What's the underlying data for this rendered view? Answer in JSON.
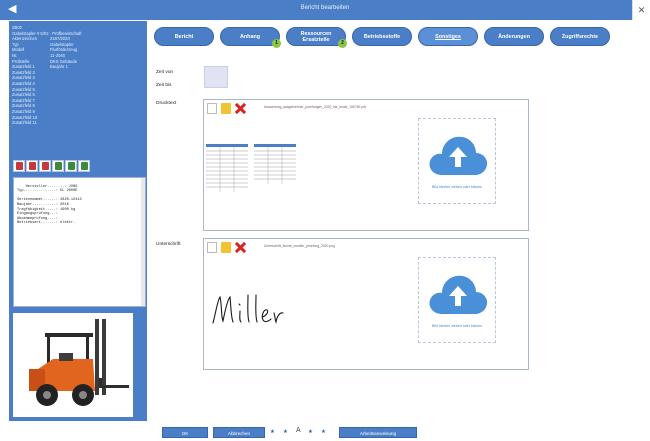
{
  "titlebar": {
    "back_icon": "arrow-left-icon",
    "title": "Bericht bearbeiten",
    "close_icon": "close-icon"
  },
  "info": {
    "heading": "ZB02",
    "subheading": "Gabelstapler # 5/02 · Prüfbereitschaft",
    "fields": [
      {
        "key": "Aktenzeichen",
        "value": "2187/2020"
      },
      {
        "key": "Typ",
        "value": "Gabelstapler"
      },
      {
        "key": "Modell",
        "value": "Flurförderzeug"
      },
      {
        "key": "Nr.",
        "value": "11-2040"
      },
      {
        "key": "Prüfstelle",
        "value": "DKS Gebäude"
      },
      {
        "key": "Zusatzfeld 1",
        "value": "Baujahr 1"
      }
    ],
    "extra_fields": [
      "Zusatzfeld 2",
      "Zusatzfeld 3",
      "Zusatzfeld 4",
      "Zusatzfeld 5",
      "Zusatzfeld 6",
      "Zusatzfeld 7",
      "Zusatzfeld 8",
      "Zusatzfeld 9",
      "Zusatzfeld 10",
      "Zusatzfeld 11"
    ]
  },
  "toolbar_icons": [
    "pdf-icon",
    "pdf-icon",
    "pdf-icon",
    "edit-icon",
    "tools-icon",
    "edit-icon"
  ],
  "notes_text": "Hersteller........: JUNG\nTyp...............: EL 2000E\n\nSeriennummer......: 2620-12413\nBaujahr...........: 2016\nTragfähigkeit.....: 1600 kg\nEingangsprüfung...:\nAbnahmeprüfung....:\nBetriebsart.......: elektr.",
  "photo_icon": "forklift-photo",
  "tabs": [
    {
      "label": "Bericht",
      "active": false
    },
    {
      "label": "Anhang",
      "active": false,
      "badge": "1"
    },
    {
      "label": "Ressourcen Ersatzteile",
      "line1": "Ressourcen",
      "line2": "Ersatzteile",
      "active": false,
      "badge": "2"
    },
    {
      "label": "Betriebsstoffe",
      "active": false
    },
    {
      "label": "Sonstiges",
      "active": true
    },
    {
      "label": "Änderungen",
      "active": false
    },
    {
      "label": "Zugriffsrechte",
      "active": false
    }
  ],
  "form": {
    "zeit_von_label": "Zeit von",
    "zeit_bis_label": "Zeit bis",
    "drucktext_label": "Drucktext",
    "unterschrift_label": "Unterschrift",
    "drucktext_file": "Auswertung_ausgefuehrter_pruefungen_2020_bis_heute_150750.pdf",
    "unterschrift_file": "Unterschrift_kunde_mueller_pruefung_2020.png",
    "upload_text": "Bild hierher ziehen oder klicken",
    "signature_text": "Müller"
  },
  "bottom": {
    "ok_label": "OK",
    "cancel_label": "Abbrechen",
    "upload_icons": [
      "upload-icon",
      "upload-icon",
      "upload-icon",
      "upload-icon"
    ],
    "mode_text": "A",
    "action_label": "Arbeitsanweisung"
  },
  "colors": {
    "accent": "#4a7fc8",
    "badge": "#8cc63f",
    "delete": "#d22222",
    "folder": "#f1c233"
  }
}
